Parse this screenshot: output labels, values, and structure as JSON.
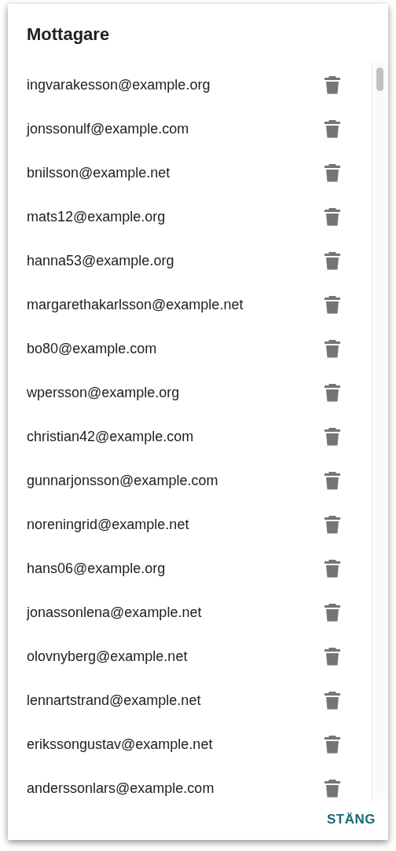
{
  "dialog": {
    "title": "Mottagare",
    "recipients": [
      {
        "email": "ingvarakesson@example.org"
      },
      {
        "email": "jonssonulf@example.com"
      },
      {
        "email": "bnilsson@example.net"
      },
      {
        "email": "mats12@example.org"
      },
      {
        "email": "hanna53@example.org"
      },
      {
        "email": "margarethakarlsson@example.net"
      },
      {
        "email": "bo80@example.com"
      },
      {
        "email": "wpersson@example.org"
      },
      {
        "email": "christian42@example.com"
      },
      {
        "email": "gunnarjonsson@example.com"
      },
      {
        "email": "noreningrid@example.net"
      },
      {
        "email": "hans06@example.org"
      },
      {
        "email": "jonassonlena@example.net"
      },
      {
        "email": "olovnyberg@example.net"
      },
      {
        "email": "lennartstrand@example.net"
      },
      {
        "email": "erikssongustav@example.net"
      },
      {
        "email": "anderssonlars@example.com"
      }
    ],
    "buttons": [
      "STÄNG"
    ]
  }
}
